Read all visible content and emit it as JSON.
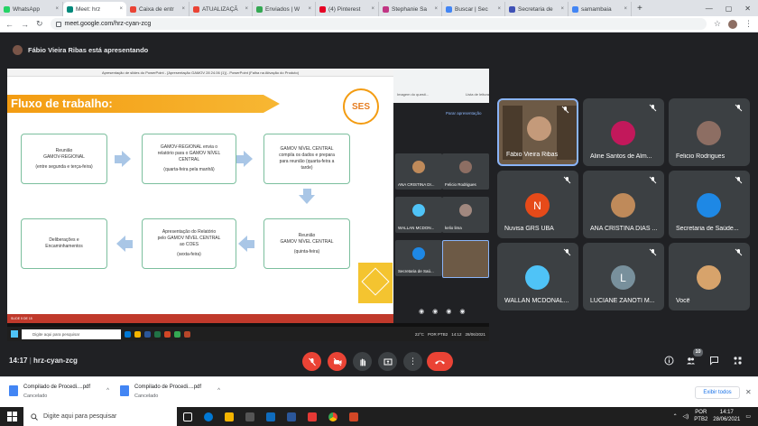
{
  "browser": {
    "tabs": [
      {
        "label": "WhatsApp",
        "color": "#25d366",
        "active": false
      },
      {
        "label": "Meet: hrz",
        "color": "#00897b",
        "active": true
      },
      {
        "label": "Caixa de entr",
        "color": "#ea4335",
        "active": false
      },
      {
        "label": "ATUALIZAÇÃ",
        "color": "#ea4335",
        "active": false
      },
      {
        "label": "Enviados | W",
        "color": "#34a853",
        "active": false
      },
      {
        "label": "(4) Pinterest",
        "color": "#e60023",
        "active": false
      },
      {
        "label": "Stephanie Sa",
        "color": "#c13584",
        "active": false
      },
      {
        "label": "Buscar | Sec",
        "color": "#4285f4",
        "active": false
      },
      {
        "label": "Secretaria de",
        "color": "#3f51b5",
        "active": false
      },
      {
        "label": "samambaia",
        "color": "#4285f4",
        "active": false
      }
    ],
    "url": "meet.google.com/hrz-cyan-zcg"
  },
  "presenter_banner": "Fábio Vieira Ribas está apresentando",
  "slide": {
    "window_title": "Apresentação de slides do PowerPoint - [Apresentação GAMOV 28 24.06 (1)] - PowerPoint (Falha na Ativação do Produto)",
    "title": "Fluxo de trabalho:",
    "logo_text": "SES",
    "boxes": [
      {
        "lines": [
          "Reunião",
          "GAMOV-REGIONAL",
          "",
          "(entre segunda e terça-feira)"
        ]
      },
      {
        "lines": [
          "GAMOV-REGIONAL envia o",
          "relatório para o GAMOV NÍVEL",
          "CENTRAL",
          "",
          "(quarta-feira pela manhã)"
        ]
      },
      {
        "lines": [
          "GAMOV NÍVEL CENTRAL",
          "compila os dados e prepara",
          "para reunião (quarta-feira a",
          "tarde)"
        ]
      },
      {
        "lines": [
          "Reunião",
          "GAMOV NÍVEL CENTRAL",
          "",
          "(quinta-feira)"
        ]
      },
      {
        "lines": [
          "Apresentação do Relatório",
          "pelo GAMOV NÍVEL CENTRAL",
          "ao COES",
          "",
          "(sexta-feira)"
        ]
      },
      {
        "lines": [
          "Deliberações e",
          "Encaminhamentos"
        ]
      }
    ],
    "status": "SLIDE 5 DE 15"
  },
  "inner_share": {
    "search_placeholder": "Digite aqui para pesquisar",
    "inner_bar_left": "Imagem do questi...",
    "inner_bar_right": "Lista de leitura",
    "inner_stop": "Parar apresentação",
    "mini_tiles": [
      "ANA CRISTINA DI...",
      "Felicio Rodrigues",
      "WALLAN MCDON...",
      "kelio lima",
      "Secretaria de Saú..."
    ],
    "weather": "22°C",
    "lang": "POR PTB2",
    "time": "14:12",
    "date": "28/06/2021"
  },
  "participants": [
    {
      "name": "Fábio Vieira Ribas",
      "type": "presenter"
    },
    {
      "name": "Aline Santos de Alm...",
      "type": "photo",
      "color": "#c2185b"
    },
    {
      "name": "Felicio Rodrigues",
      "type": "photo",
      "color": "#8d6e63"
    },
    {
      "name": "Nuvisa GRS UBÁ",
      "type": "initial",
      "initial": "N",
      "color": "#e64a19"
    },
    {
      "name": "ANA CRISTINA DIAS ...",
      "type": "photo",
      "color": "#bf8a5a"
    },
    {
      "name": "Secretaria de Saúde...",
      "type": "photo",
      "color": "#1e88e5"
    },
    {
      "name": "WALLAN MCDONAL...",
      "type": "photo",
      "color": "#4fc3f7"
    },
    {
      "name": "LUCIANE ZANOTI M...",
      "type": "initial",
      "initial": "L",
      "color": "#78909c"
    },
    {
      "name": "Você",
      "type": "photo",
      "color": "#d7a36b"
    }
  ],
  "meeting": {
    "time": "14:17",
    "code": "hrz-cyan-zcg",
    "participant_count": "10"
  },
  "downloads": [
    {
      "name": "Compilado de Procedi....pdf",
      "status": "Cancelado"
    },
    {
      "name": "Compilado de Procedi....pdf",
      "status": "Cancelado"
    }
  ],
  "downloads_show_all": "Exibir todos",
  "taskbar": {
    "search_placeholder": "Digite aqui para pesquisar",
    "lang": "POR",
    "lang2": "PTB2",
    "time": "14:17",
    "date": "28/06/2021"
  }
}
